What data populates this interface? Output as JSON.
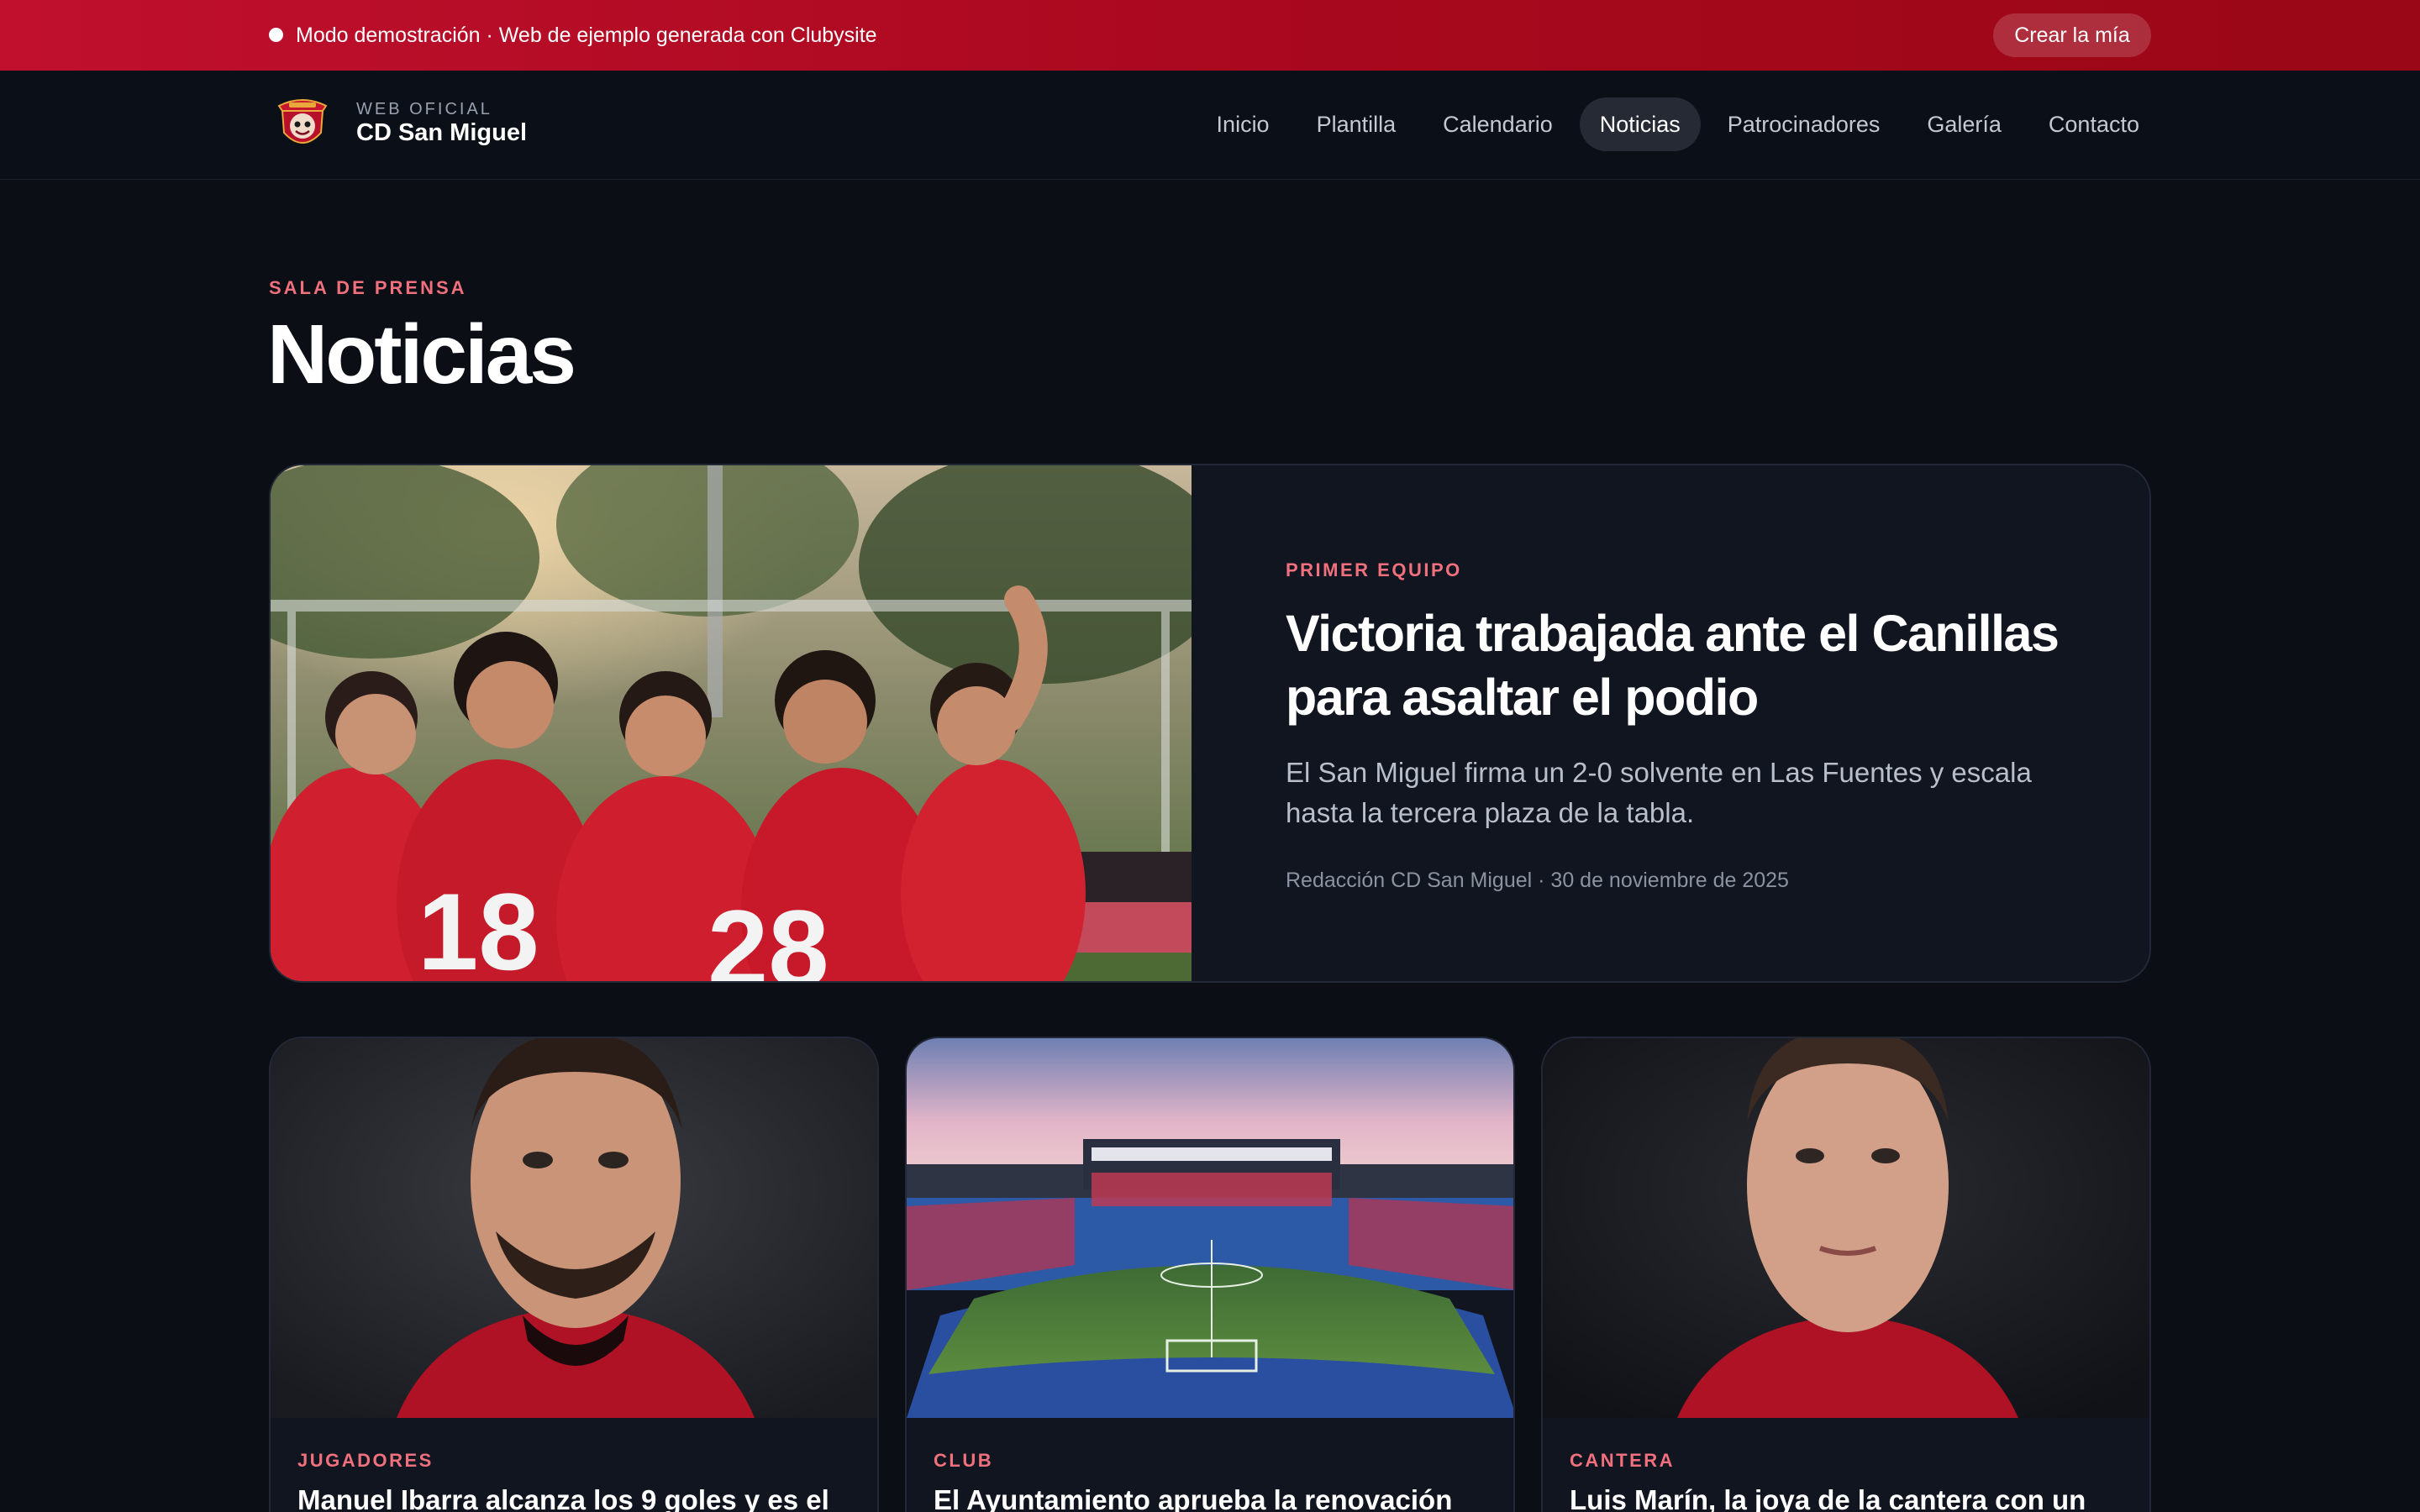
{
  "demo_banner": {
    "text": "Modo demostración · Web de ejemplo generada con Clubysite",
    "cta": "Crear la mía"
  },
  "header": {
    "kicker": "WEB OFICIAL",
    "club_name": "CD San Miguel",
    "logo_icon": "club-crest-icon",
    "nav": [
      {
        "label": "Inicio",
        "active": false
      },
      {
        "label": "Plantilla",
        "active": false
      },
      {
        "label": "Calendario",
        "active": false
      },
      {
        "label": "Noticias",
        "active": true
      },
      {
        "label": "Patrocinadores",
        "active": false
      },
      {
        "label": "Galería",
        "active": false
      },
      {
        "label": "Contacto",
        "active": false
      }
    ]
  },
  "page": {
    "kicker": "SALA DE PRENSA",
    "title": "Noticias"
  },
  "featured": {
    "category": "PRIMER EQUIPO",
    "title": "Victoria trabajada ante el Canillas para asaltar el podio",
    "summary": "El San Miguel firma un 2-0 solvente en Las Fuentes y escala hasta la tercera plaza de la tabla.",
    "meta": "Redacción CD San Miguel · 30 de noviembre de 2025",
    "photo_numbers": [
      "18",
      "28"
    ]
  },
  "cards": [
    {
      "category": "JUGADORES",
      "title": "Manuel Ibarra alcanza los 9 goles y es el"
    },
    {
      "category": "CLUB",
      "title": "El Ayuntamiento aprueba la renovación del"
    },
    {
      "category": "CANTERA",
      "title": "Luis Marín, la joya de la cantera con un"
    }
  ],
  "colors": {
    "accent": "#f0707e",
    "banner": "#c0102e",
    "background": "#0b0e15",
    "card": "#111520"
  }
}
